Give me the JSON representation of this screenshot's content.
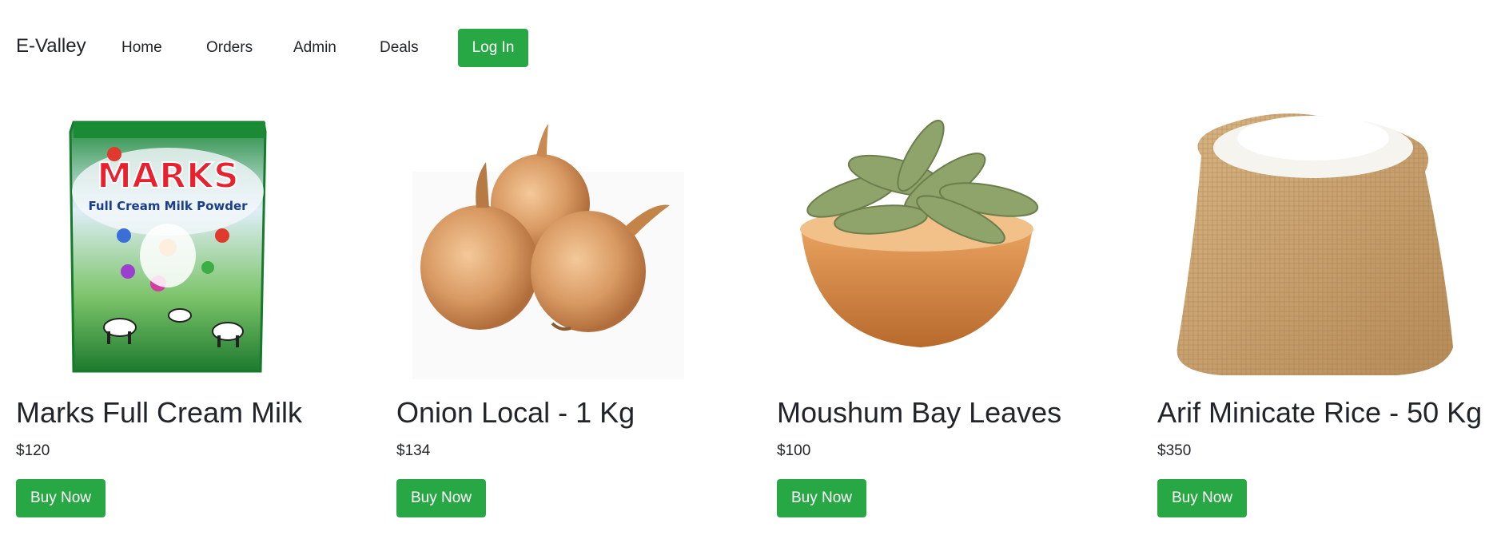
{
  "navbar": {
    "brand": "E-Valley",
    "links": [
      "Home",
      "Orders",
      "Admin",
      "Deals"
    ],
    "login_label": "Log In"
  },
  "colors": {
    "accent": "#28a745",
    "text": "#212529"
  },
  "products": [
    {
      "name": "Marks Full Cream Milk",
      "price": "$120",
      "button": "Buy Now",
      "image_icon": "milk-powder-packet-image",
      "package_text": {
        "brand": "MARKS",
        "subtitle": "Full Cream Milk Powder"
      }
    },
    {
      "name": "Onion Local - 1 Kg",
      "price": "$134",
      "button": "Buy Now",
      "image_icon": "onions-image"
    },
    {
      "name": "Moushum Bay Leaves",
      "price": "$100",
      "button": "Buy Now",
      "image_icon": "bay-leaves-bowl-image"
    },
    {
      "name": "Arif Minicate Rice - 50 Kg",
      "price": "$350",
      "button": "Buy Now",
      "image_icon": "rice-sack-image"
    }
  ]
}
